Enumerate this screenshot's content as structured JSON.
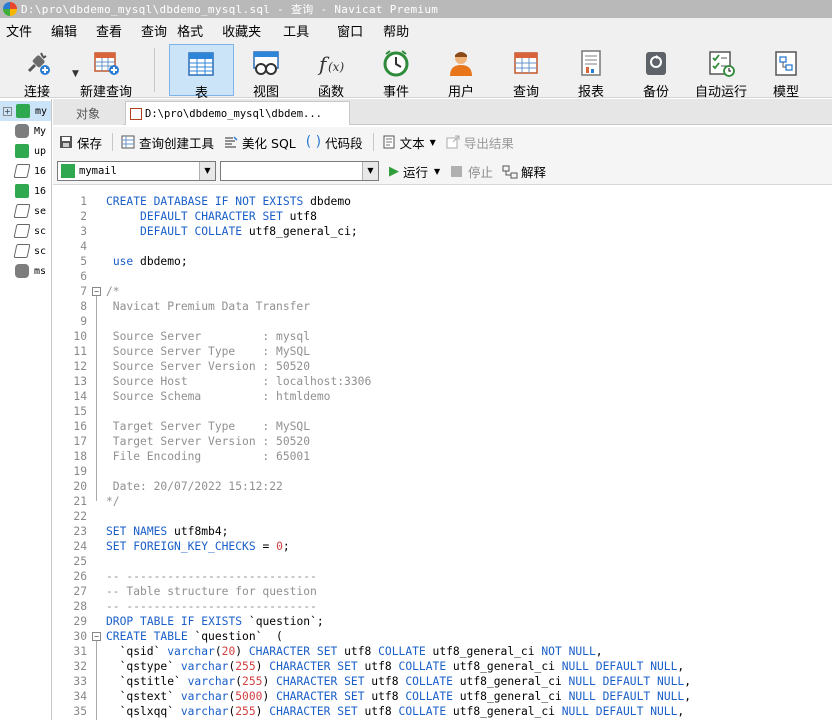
{
  "window": {
    "title": "D:\\pro\\dbdemo_mysql\\dbdemo_mysql.sql - 查询 - Navicat Premium"
  },
  "menu": [
    "文件",
    "编辑",
    "查看",
    "查询",
    "格式",
    "收藏夹",
    "工具",
    "窗口",
    "帮助"
  ],
  "toolbar": {
    "buttons": [
      {
        "label": "连接",
        "icon": "connect-icon"
      },
      {
        "label": "新建查询",
        "icon": "new-query-icon"
      },
      {
        "label": "表",
        "icon": "table-icon",
        "active": true
      },
      {
        "label": "视图",
        "icon": "view-icon"
      },
      {
        "label": "函数",
        "icon": "function-icon"
      },
      {
        "label": "事件",
        "icon": "event-icon"
      },
      {
        "label": "用户",
        "icon": "user-icon"
      },
      {
        "label": "查询",
        "icon": "query-icon"
      },
      {
        "label": "报表",
        "icon": "report-icon"
      },
      {
        "label": "备份",
        "icon": "backup-icon"
      },
      {
        "label": "自动运行",
        "icon": "automation-icon"
      },
      {
        "label": "模型",
        "icon": "model-icon"
      }
    ]
  },
  "tree": {
    "items": [
      {
        "label": "my",
        "icon": "connection-icon",
        "selected": true,
        "expander": "+"
      },
      {
        "label": "My",
        "icon": "database-icon"
      },
      {
        "label": "up",
        "icon": "connection-icon"
      },
      {
        "label": "16",
        "icon": "query-file-icon"
      },
      {
        "label": "16",
        "icon": "connection-icon"
      },
      {
        "label": "se",
        "icon": "query-file-icon"
      },
      {
        "label": "sc",
        "icon": "query-file-icon"
      },
      {
        "label": "sc",
        "icon": "query-file-icon"
      },
      {
        "label": "ms",
        "icon": "database-icon"
      }
    ]
  },
  "tabs": {
    "objects": "对象",
    "query": "D:\\pro\\dbdemo_mysql\\dbdem..."
  },
  "query_toolbar": {
    "save": "保存",
    "builder": "查询创建工具",
    "beautify": "美化 SQL",
    "snippet": "代码段",
    "text": "文本",
    "export": "导出结果"
  },
  "selectors": {
    "connection": "mymail",
    "database": "",
    "run": "运行",
    "stop": "停止",
    "explain": "解释"
  },
  "code_lines": [
    {
      "n": "1",
      "t": "CREATE DATABASE IF NOT EXISTS dbdemo"
    },
    {
      "n": "2",
      "t": "     DEFAULT CHARACTER SET utf8"
    },
    {
      "n": "3",
      "t": "     DEFAULT COLLATE utf8_general_ci;"
    },
    {
      "n": "4",
      "t": ""
    },
    {
      "n": "5",
      "t": " use dbdemo;"
    },
    {
      "n": "6",
      "t": ""
    },
    {
      "n": "7",
      "t": "/*"
    },
    {
      "n": "8",
      "t": " Navicat Premium Data Transfer"
    },
    {
      "n": "9",
      "t": ""
    },
    {
      "n": "10",
      "t": " Source Server         : mysql"
    },
    {
      "n": "11",
      "t": " Source Server Type    : MySQL"
    },
    {
      "n": "12",
      "t": " Source Server Version : 50520"
    },
    {
      "n": "13",
      "t": " Source Host           : localhost:3306"
    },
    {
      "n": "14",
      "t": " Source Schema         : htmldemo"
    },
    {
      "n": "15",
      "t": ""
    },
    {
      "n": "16",
      "t": " Target Server Type    : MySQL"
    },
    {
      "n": "17",
      "t": " Target Server Version : 50520"
    },
    {
      "n": "18",
      "t": " File Encoding         : 65001"
    },
    {
      "n": "19",
      "t": ""
    },
    {
      "n": "20",
      "t": " Date: 20/07/2022 15:12:22"
    },
    {
      "n": "21",
      "t": "*/"
    },
    {
      "n": "22",
      "t": ""
    },
    {
      "n": "23",
      "t": "SET NAMES utf8mb4;"
    },
    {
      "n": "24",
      "t": "SET FOREIGN_KEY_CHECKS = 0;"
    },
    {
      "n": "25",
      "t": ""
    },
    {
      "n": "26",
      "t": "-- ----------------------------"
    },
    {
      "n": "27",
      "t": "-- Table structure for question"
    },
    {
      "n": "28",
      "t": "-- ----------------------------"
    },
    {
      "n": "29",
      "t": "DROP TABLE IF EXISTS `question`;"
    },
    {
      "n": "30",
      "t": "CREATE TABLE `question`  ("
    },
    {
      "n": "31",
      "t": "  `qsid` varchar(20) CHARACTER SET utf8 COLLATE utf8_general_ci NOT NULL,"
    },
    {
      "n": "32",
      "t": "  `qstype` varchar(255) CHARACTER SET utf8 COLLATE utf8_general_ci NULL DEFAULT NULL,"
    },
    {
      "n": "33",
      "t": "  `qstitle` varchar(255) CHARACTER SET utf8 COLLATE utf8_general_ci NULL DEFAULT NULL,"
    },
    {
      "n": "34",
      "t": "  `qstext` varchar(5000) CHARACTER SET utf8 COLLATE utf8_general_ci NULL DEFAULT NULL,"
    },
    {
      "n": "35",
      "t": "  `qslxqq` varchar(255) CHARACTER SET utf8 COLLATE utf8_general_ci NULL DEFAULT NULL,"
    }
  ],
  "colors": {
    "keyword": "#1a5fc8",
    "comment": "#909090",
    "number_red": "#d04040",
    "active_button_bg": "#cce4f7"
  }
}
